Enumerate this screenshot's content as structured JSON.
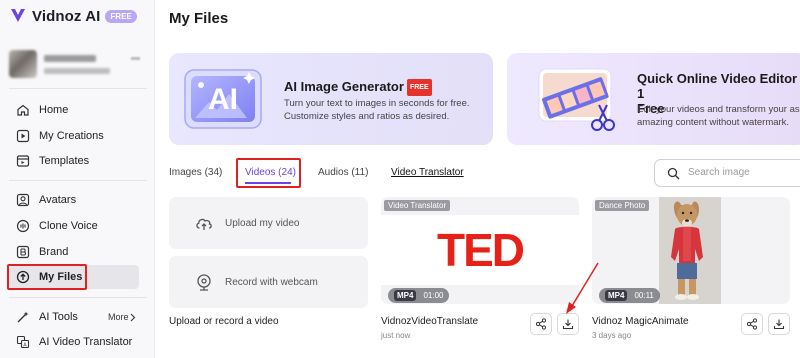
{
  "app": {
    "name": "Vidnoz AI",
    "badge": "FREE"
  },
  "sidebar": {
    "nav": [
      {
        "label": "Home",
        "icon": "home-icon"
      },
      {
        "label": "My Creations",
        "icon": "play-square-icon"
      },
      {
        "label": "Templates",
        "icon": "templates-icon"
      },
      {
        "label": "Avatars",
        "icon": "avatar-icon"
      },
      {
        "label": "Clone Voice",
        "icon": "voice-icon"
      },
      {
        "label": "Brand",
        "icon": "brand-icon"
      },
      {
        "label": "My Files",
        "icon": "upload-cloud-icon",
        "active": true
      },
      {
        "label": "AI Tools",
        "icon": "ai-tools-icon"
      },
      {
        "label": "AI Video Translator",
        "icon": "translate-icon"
      }
    ],
    "more_label": "More"
  },
  "page": {
    "title": "My Files"
  },
  "banners": [
    {
      "title": "AI Image Generator",
      "badge": "FREE",
      "desc_line1": "Turn your text to images in seconds for free.",
      "desc_line2": "Customize styles and ratios as desired.",
      "art_label": "AI"
    },
    {
      "title_line1": "Quick Online Video Editor - 1",
      "title_line2": "Free",
      "desc_line1": "Edit your videos and transform your as",
      "desc_line2": "amazing content without watermark."
    }
  ],
  "tabs": [
    {
      "label": "Images (34)"
    },
    {
      "label": "Videos (24)",
      "active": true
    },
    {
      "label": "Audios (11)"
    }
  ],
  "video_translator_link": "Video Translator",
  "search": {
    "placeholder": "Search image"
  },
  "upload": {
    "upload_label": "Upload my video",
    "record_label": "Record with webcam",
    "caption": "Upload or record a video"
  },
  "videos": [
    {
      "tag": "Video Translator",
      "thumb_text": "TED",
      "format": "MP4",
      "duration": "01:00",
      "title": "VidnozVideoTranslate",
      "time": "just now"
    },
    {
      "tag": "Dance Photo",
      "format": "MP4",
      "duration": "00:11",
      "title": "Vidnoz MagicAnimate",
      "time": "3 days ago"
    }
  ],
  "colors": {
    "accent": "#6b44e6",
    "highlight": "#e02121",
    "free_badge": "#b9a6f4"
  }
}
